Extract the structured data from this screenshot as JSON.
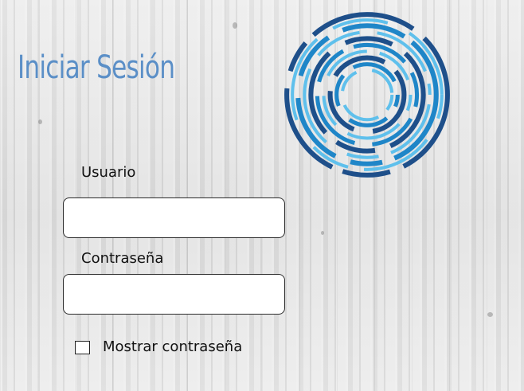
{
  "login": {
    "title": "Iniciar Sesión",
    "username_label": "Usuario",
    "username_value": "",
    "password_label": "Contraseña",
    "password_value": "",
    "show_password_label": "Mostrar contraseña",
    "show_password_checked": false
  },
  "logo": {
    "icon": "concentric-rings-logo-icon"
  },
  "colors": {
    "title": "#5b8fc7",
    "logo_dark": "#1e4f8a",
    "logo_mid": "#1f86c8",
    "logo_light": "#5fc0ec"
  }
}
